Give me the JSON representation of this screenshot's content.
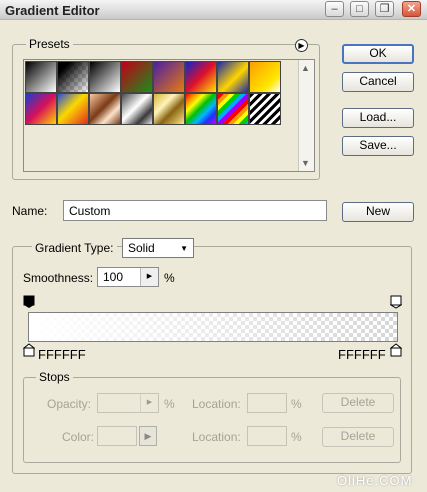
{
  "window": {
    "title": "Gradient Editor"
  },
  "presets": {
    "legend": "Presets",
    "swatches": [
      "linear-gradient(135deg,#000 0%,#fff 100%)",
      "linear-gradient(135deg,#000 0%,#000 20%,rgba(255,255,255,0) 100%)",
      "linear-gradient(135deg,#000 0%,#fff 100%)",
      "linear-gradient(135deg,#c0001a 0%,#1a8f1a 100%)",
      "linear-gradient(135deg,#4b1fa3 0%,#e87a10 100%)",
      "linear-gradient(135deg,#1025c8 0%,#e0102a 50%,#ffe500 100%)",
      "linear-gradient(135deg,#1a2ca8 0%,#ffd400 55%,#1a2ca8 100%)",
      "linear-gradient(135deg,#ff9c00 0%,#ffe800 70%,#ffffff 100%)",
      "linear-gradient(135deg,#1b3fd0 0%,#d80f5a 50%,#ffd500 100%)",
      "linear-gradient(135deg,#2a4fd8 0%,#fbd800 45%,#e12d20 100%)",
      "linear-gradient(135deg,#f7c8a4 0%,#7a3a14 45%,#fde2cb 70%,#7a3a14 100%)",
      "linear-gradient(135deg,#4a4a4a 0%,#ffffff 45%,#3a3a3a 75%,#e0e0e0 100%)",
      "linear-gradient(135deg,#d7b33a 0%,#fff4b8 35%,#8a6410 60%,#ffe38a 100%)",
      "linear-gradient(135deg,#ff0000 0%,#ff8a00 15%,#ffff00 30%,#00c000 47%,#00b8ff 64%,#2030ff 80%,#c000ff 100%)",
      "repeating-linear-gradient(135deg,#ff0000 0 4px,#ff9900 4px 8px,#ffff00 8px 12px,#00cc00 12px 16px,#00aaff 16px 20px,#9900ff 20px 24px)",
      "repeating-linear-gradient(135deg,#000 0 3px,#fff 3px 6px)"
    ],
    "menu_icon": "arrow-circle-icon"
  },
  "buttons": {
    "ok": "OK",
    "cancel": "Cancel",
    "load": "Load...",
    "save": "Save...",
    "new": "New"
  },
  "name": {
    "label": "Name:",
    "value": "Custom"
  },
  "gradient": {
    "type_label": "Gradient Type:",
    "type_value": "Solid",
    "smoothness_label": "Smoothness:",
    "smoothness_value": "100",
    "percent": "%",
    "left_color": "FFFFFF",
    "right_color": "FFFFFF",
    "bar_fill": "linear-gradient(to right, rgba(255,255,255,1) 0%, rgba(255,255,255,0) 100%)"
  },
  "stops": {
    "legend": "Stops",
    "opacity_label": "Opacity:",
    "opacity_unit": "%",
    "color_label": "Color:",
    "location_label": "Location:",
    "location_unit": "%",
    "delete_label": "Delete"
  },
  "watermark": "OliHe.COM"
}
